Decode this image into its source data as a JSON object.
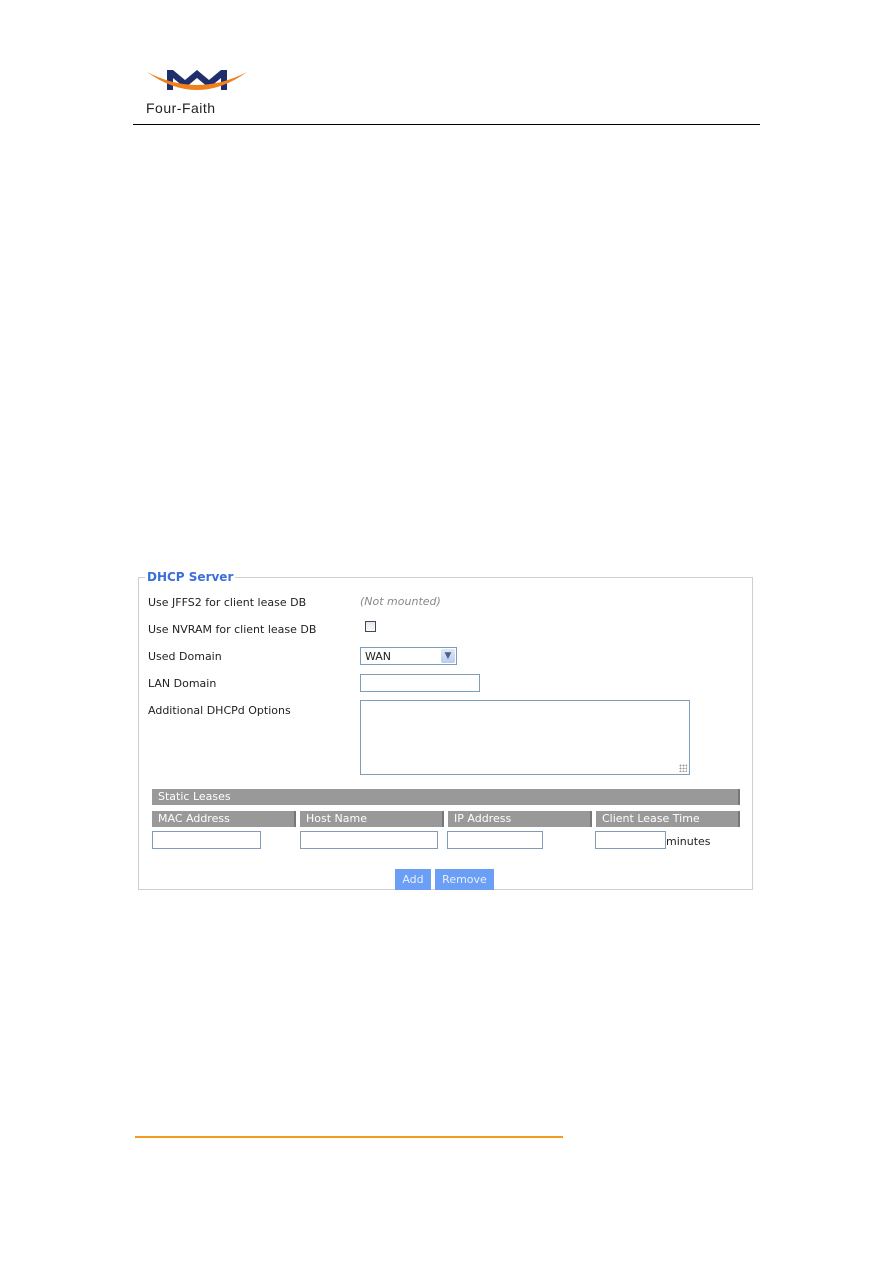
{
  "header": {
    "brand": "Four-Faith",
    "brand_colors": {
      "arc": "#f07f1c",
      "mark": "#1f2f6b"
    }
  },
  "dhcp_server": {
    "legend": "DHCP Server",
    "rows": [
      {
        "label": "Use JFFS2 for client lease DB",
        "value": "(Not mounted)"
      },
      {
        "label": "Use NVRAM for client lease DB",
        "checked": false
      },
      {
        "label": "Used Domain",
        "selected": "WAN"
      },
      {
        "label": "LAN Domain",
        "value": ""
      },
      {
        "label": "Additional DHCPd Options",
        "value": ""
      }
    ],
    "static_leases": {
      "title": "Static Leases",
      "columns": [
        "MAC Address",
        "Host Name",
        "IP Address",
        "Client Lease Time"
      ],
      "row": {
        "mac": "",
        "host": "",
        "ip": "",
        "lease_time": "",
        "unit": "minutes"
      }
    },
    "buttons": {
      "add": "Add",
      "remove": "Remove"
    }
  },
  "colors": {
    "accent": "#3c6ed8",
    "button": "#6b9ef5",
    "header_bar": "#999999",
    "footer_rule": "#f39c1e"
  }
}
